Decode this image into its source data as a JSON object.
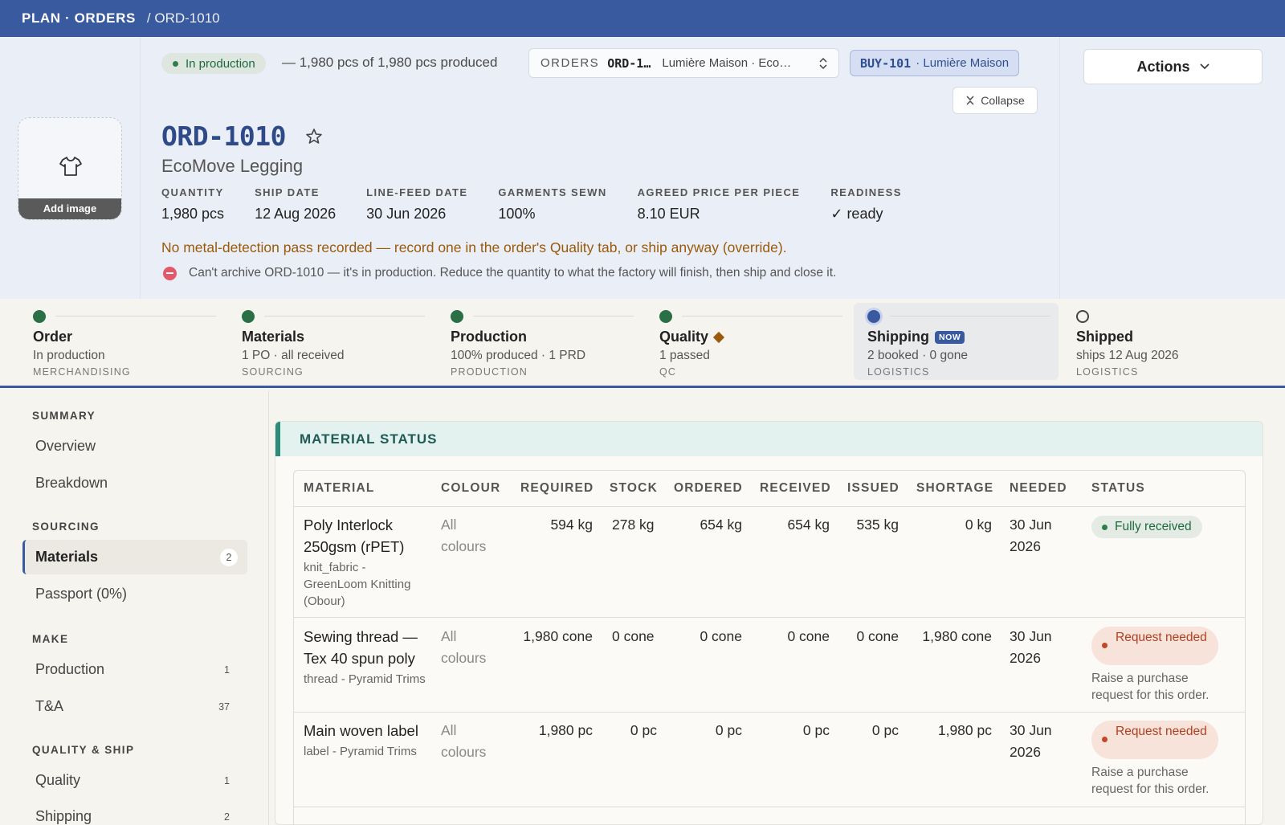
{
  "topbar": {
    "root": "PLAN · ORDERS",
    "current": "/ ORD-1010"
  },
  "header": {
    "add_image_label": "Add image",
    "status": "In production",
    "produced_text": "— 1,980 pcs of 1,980 pcs produced",
    "order_selector": {
      "label": "ORDERS",
      "code": "ORD-1…",
      "desc": "Lumière Maison · Eco…"
    },
    "buyer_chip": {
      "code": "BUY-101",
      "desc": "· Lumière Maison"
    },
    "collapse_label": "Collapse",
    "actions_label": "Actions",
    "order_code": "ORD-1010",
    "product_name": "EcoMove Legging",
    "facts": [
      {
        "key": "QUANTITY",
        "value": "1,980 pcs"
      },
      {
        "key": "SHIP DATE",
        "value": "12 Aug 2026"
      },
      {
        "key": "LINE-FEED DATE",
        "value": "30 Jun 2026"
      },
      {
        "key": "GARMENTS SEWN",
        "value": "100%"
      },
      {
        "key": "AGREED PRICE PER PIECE",
        "value": "8.10 EUR"
      },
      {
        "key": "READINESS",
        "value": "✓ ready"
      }
    ],
    "warning": "No metal-detection pass recorded — record one in the order's Quality tab, or ship anyway (override).",
    "error": "Can't archive ORD-1010 — it's in production. Reduce the quantity to what the factory will finish, then ship and close it."
  },
  "steps": [
    {
      "title": "Order",
      "sub": "In production",
      "cat": "MERCHANDISING"
    },
    {
      "title": "Materials",
      "sub": "1 PO · all received",
      "cat": "SOURCING"
    },
    {
      "title": "Production",
      "sub": "100% produced · 1 PRD",
      "cat": "PRODUCTION"
    },
    {
      "title": "Quality",
      "sub": "1 passed",
      "cat": "QC"
    },
    {
      "title": "Shipping",
      "badge": "NOW",
      "sub": "2 booked · 0 gone",
      "cat": "LOGISTICS"
    },
    {
      "title": "Shipped",
      "sub": "ships 12 Aug 2026",
      "cat": "LOGISTICS"
    }
  ],
  "sidebar": {
    "sections": [
      "SUMMARY",
      "SOURCING",
      "MAKE",
      "QUALITY & SHIP"
    ],
    "items": [
      {
        "label": "Overview",
        "count": ""
      },
      {
        "label": "Breakdown",
        "count": ""
      },
      {
        "label": "Materials",
        "count": "2"
      },
      {
        "label": "Passport (0%)",
        "count": ""
      },
      {
        "label": "Production",
        "count": "1"
      },
      {
        "label": "T&A",
        "count": "37"
      },
      {
        "label": "Quality",
        "count": "1"
      },
      {
        "label": "Shipping",
        "count": "2"
      }
    ]
  },
  "material_status": {
    "title": "MATERIAL STATUS",
    "columns": [
      "MATERIAL",
      "COLOUR",
      "REQUIRED",
      "STOCK",
      "ORDERED",
      "RECEIVED",
      "ISSUED",
      "SHORTAGE",
      "NEEDED",
      "STATUS"
    ],
    "rows": [
      {
        "name": "Poly Interlock 250gsm (rPET)",
        "sub": "knit_fabric - GreenLoom Knitting (Obour)",
        "colour": "All colours",
        "required": "594 kg",
        "stock": "278 kg",
        "ordered": "654 kg",
        "received": "654 kg",
        "issued": "535 kg",
        "shortage": "0 kg",
        "needed": "30 Jun 2026",
        "status": "Fully received",
        "hint": ""
      },
      {
        "name": "Sewing thread — Tex 40 spun poly",
        "sub": "thread - Pyramid Trims",
        "colour": "All colours",
        "required": "1,980 cone",
        "stock": "0 cone",
        "ordered": "0 cone",
        "received": "0 cone",
        "issued": "0 cone",
        "shortage": "1,980 cone",
        "needed": "30 Jun 2026",
        "status": "Request needed",
        "hint": "Raise a purchase request for this order."
      },
      {
        "name": "Main woven label",
        "sub": "label - Pyramid Trims",
        "colour": "All colours",
        "required": "1,980 pc",
        "stock": "0 pc",
        "ordered": "0 pc",
        "received": "0 pc",
        "issued": "0 pc",
        "shortage": "1,980 pc",
        "needed": "30 Jun 2026",
        "status": "Request needed",
        "hint": "Raise a purchase request for this order."
      }
    ]
  },
  "colors": {
    "brand": "#3a5aa0",
    "step_done": "#2a6f46",
    "warning": "#9a5a0a",
    "error": "#e25a6a"
  }
}
